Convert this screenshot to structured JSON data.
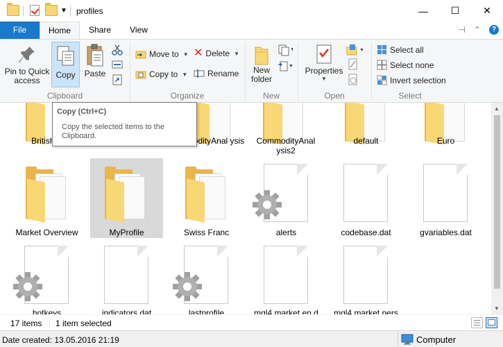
{
  "window": {
    "title": "profiles",
    "minimize": "—",
    "maximize": "☐",
    "close": "✕"
  },
  "ribbon_tabs": {
    "file": "File",
    "home": "Home",
    "share": "Share",
    "view": "View"
  },
  "clipboard": {
    "group": "Clipboard",
    "pin": "Pin to Quick access",
    "copy": "Copy",
    "paste": "Paste"
  },
  "organize": {
    "group": "Organize",
    "move_to": "Move to",
    "copy_to": "Copy to",
    "delete": "Delete",
    "rename": "Rename"
  },
  "new": {
    "group": "New",
    "new_folder": "New folder"
  },
  "open": {
    "group": "Open",
    "properties": "Properties"
  },
  "select": {
    "group": "Select",
    "select_all": "Select all",
    "select_none": "Select none",
    "invert": "Invert selection"
  },
  "tooltip": {
    "title": "Copy (Ctrl+C)",
    "body": "Copy the selected items to the Clipboard."
  },
  "items": [
    {
      "name": "British P",
      "type": "folder"
    },
    {
      "name": "modityAnal ysis",
      "type": "folder"
    },
    {
      "name": "CommodityAnal ysis2",
      "type": "folder"
    },
    {
      "name": "default",
      "type": "folder"
    },
    {
      "name": "Euro",
      "type": "folder"
    },
    {
      "name": "Market Overview",
      "type": "folder"
    },
    {
      "name": "MyProfile",
      "type": "folder",
      "selected": true
    },
    {
      "name": "Swiss Franc",
      "type": "folder"
    },
    {
      "name": "alerts",
      "type": "settings-file"
    },
    {
      "name": "codebase.dat",
      "type": "file"
    },
    {
      "name": "gvariables.dat",
      "type": "file"
    },
    {
      "name": "hotkeys",
      "type": "settings-file"
    },
    {
      "name": "indicators.dat",
      "type": "file"
    },
    {
      "name": "lastprofile",
      "type": "settings-file"
    },
    {
      "name": "mql4.market.en.d",
      "type": "file"
    },
    {
      "name": "mql4.market.pers",
      "type": "file"
    }
  ],
  "status": {
    "count": "17 items",
    "selected": "1 item selected"
  },
  "details": {
    "date_created": "Date created: 13.05.2016 21:19",
    "location": "Computer"
  }
}
